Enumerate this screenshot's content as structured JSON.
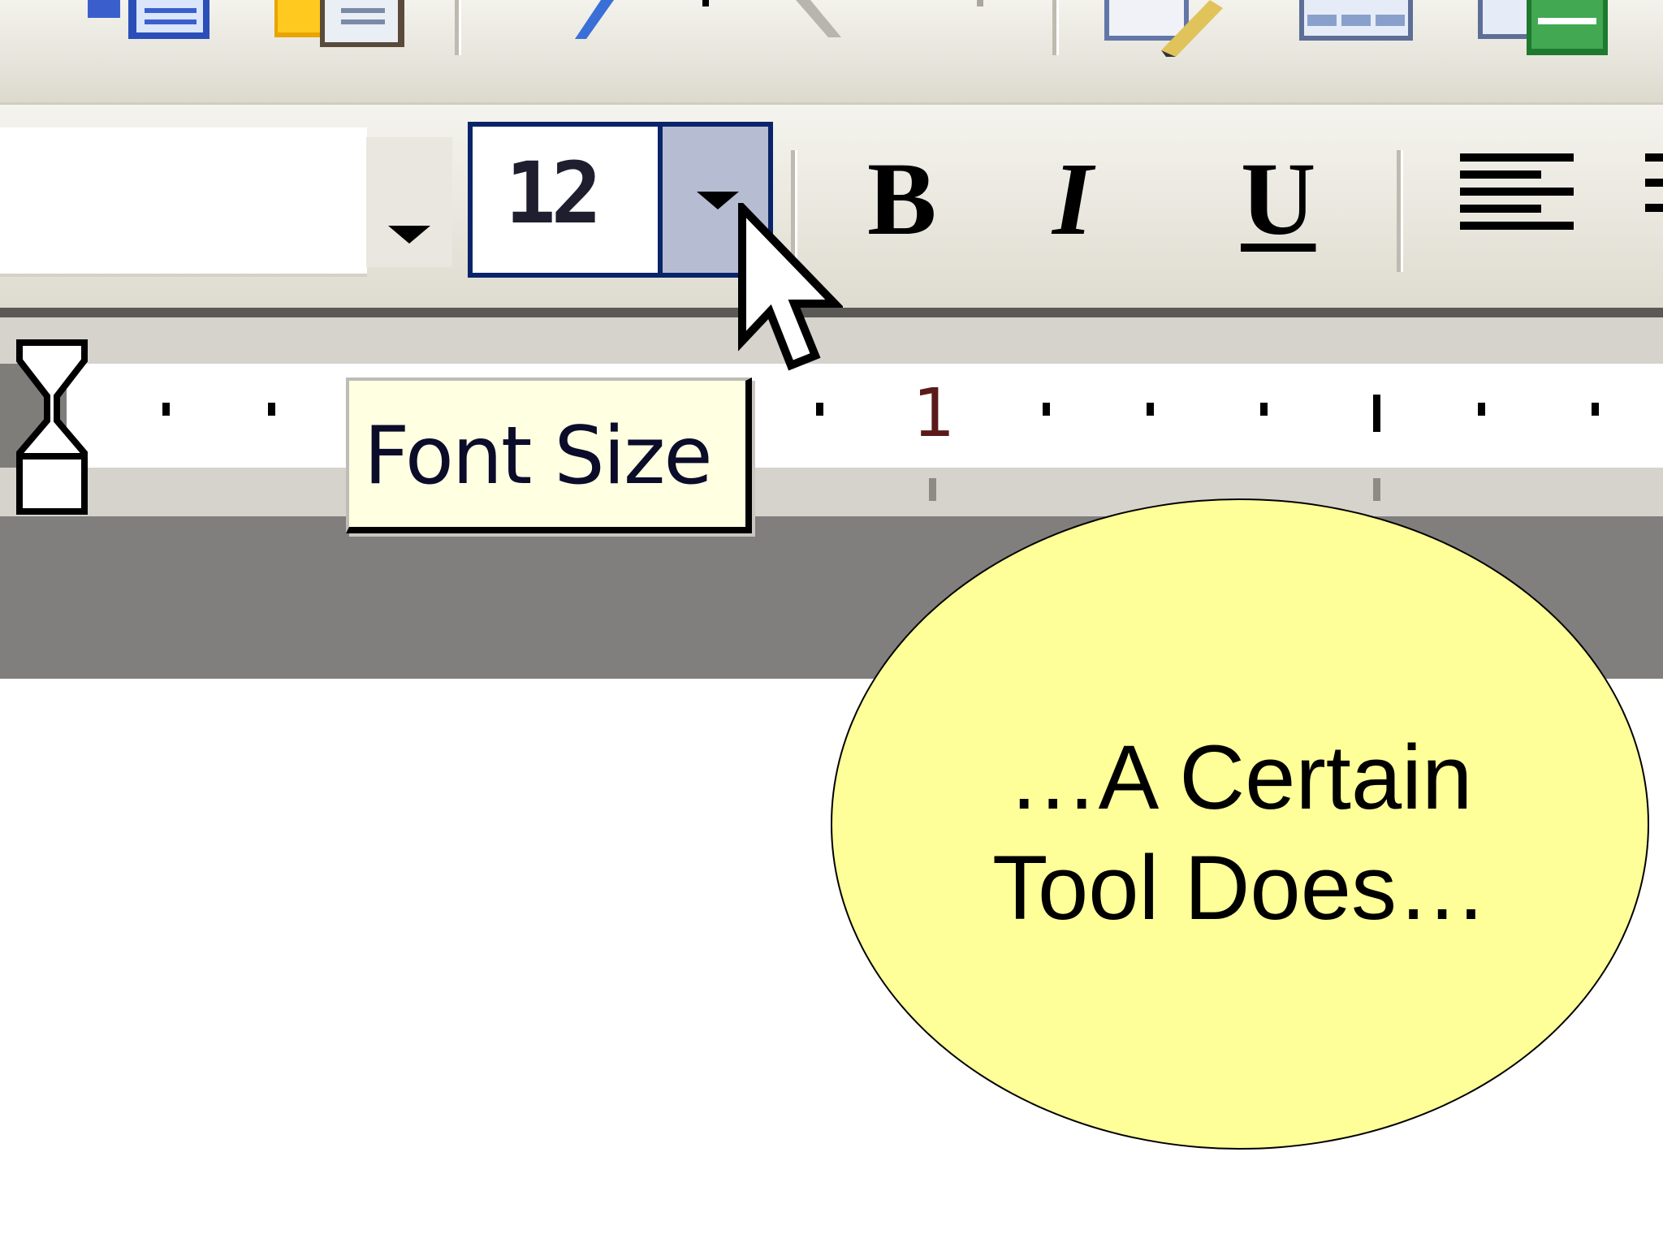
{
  "formatting_toolbar": {
    "font_size_value": "12",
    "bold_label": "B",
    "italic_label": "I",
    "underline_label": "U"
  },
  "ruler": {
    "number_label": "1"
  },
  "tooltip": {
    "text": "Font Size"
  },
  "callout": {
    "line1": "…A Certain",
    "line2": "Tool Does…"
  },
  "icons": {
    "std_toolbar": [
      "document-map-icon",
      "paste-icon",
      "undo-icon",
      "redo-icon",
      "drawing-icon",
      "table-icon",
      "excel-icon"
    ],
    "align": "align-left-icon",
    "cursor": "mouse-pointer-icon",
    "ruler_marker": "indent-marker-icon"
  },
  "colors": {
    "selection_border": "#0a246a",
    "selection_fill": "#b6bdd2",
    "tooltip_bg": "#ffffe1",
    "callout_fill": "#ffff99"
  }
}
